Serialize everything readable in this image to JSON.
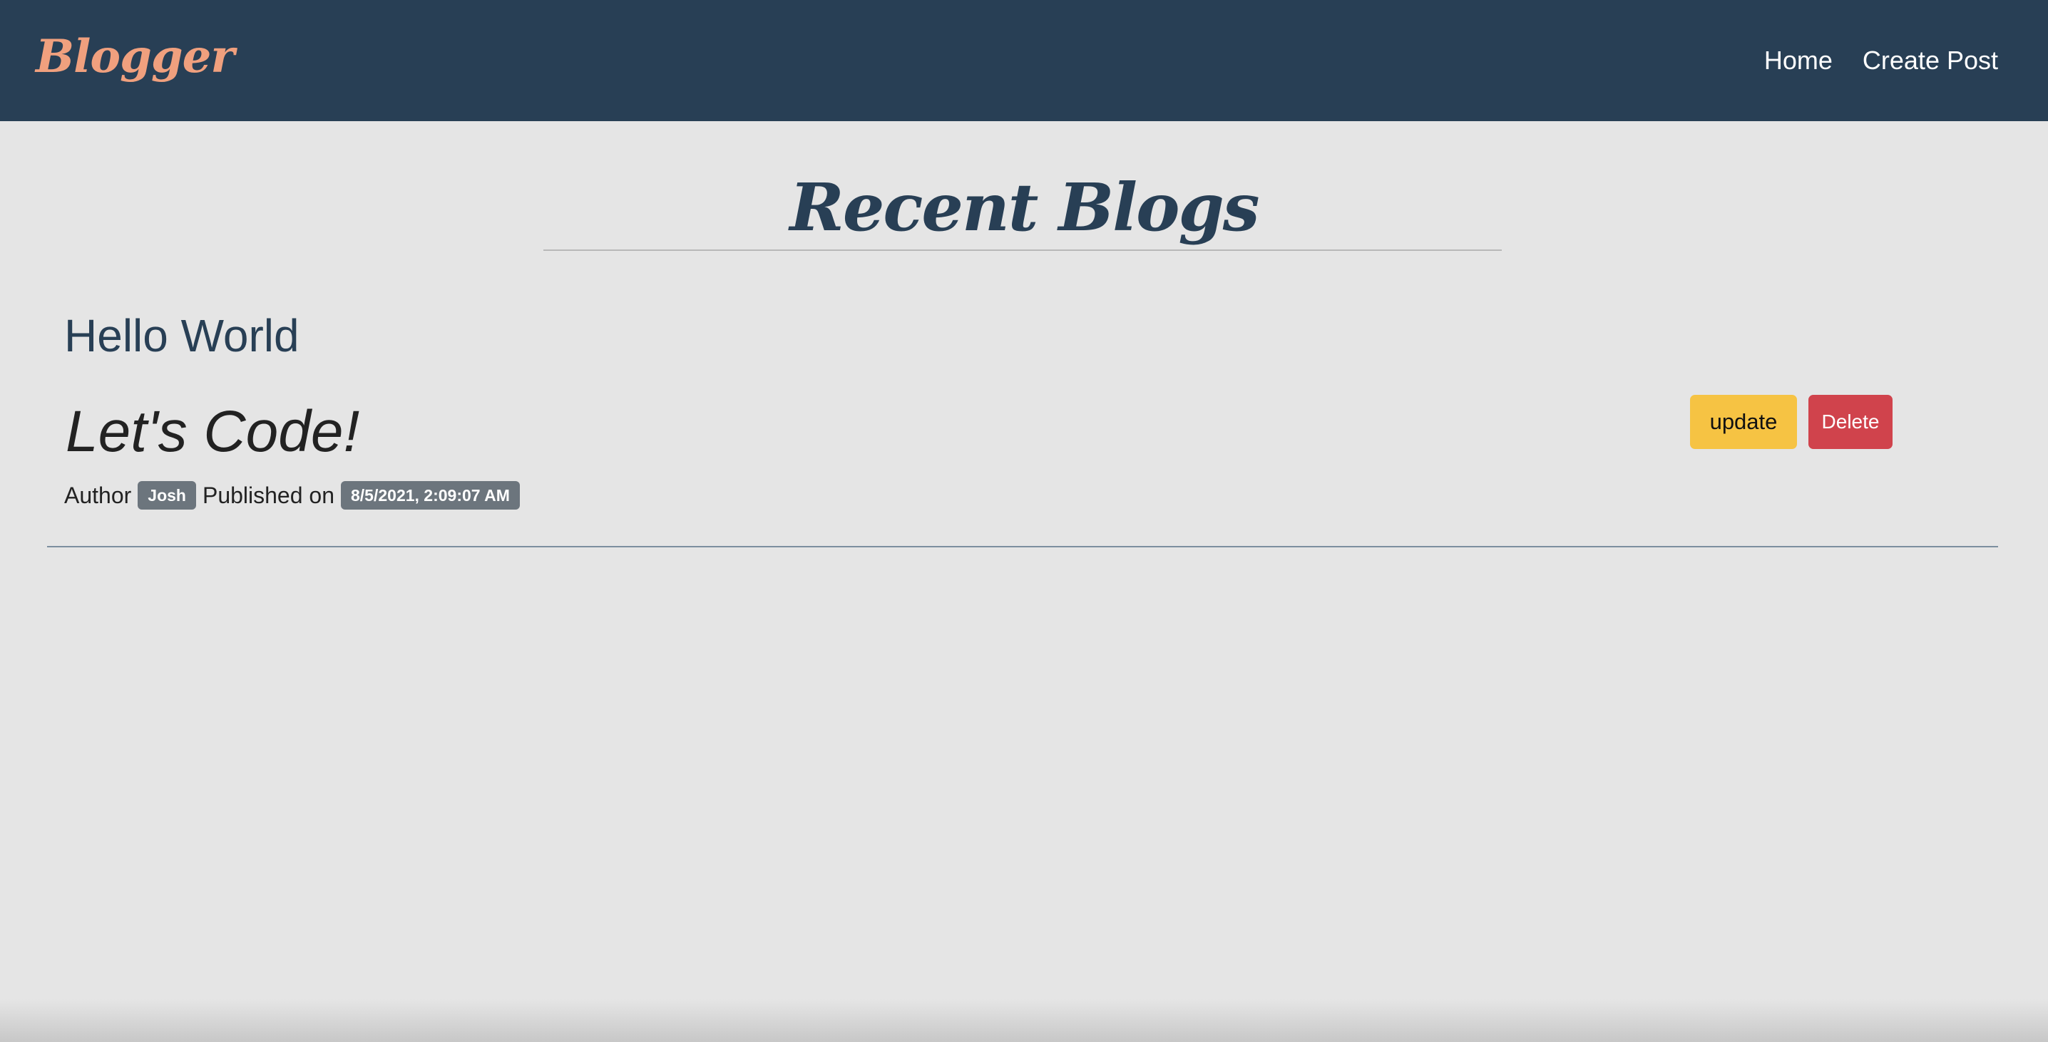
{
  "navbar": {
    "brand": "Blogger",
    "links": [
      {
        "label": "Home"
      },
      {
        "label": "Create Post"
      }
    ],
    "background_color": "#283f55",
    "brand_color": "#f0a07e"
  },
  "main": {
    "title": "Recent Blogs",
    "posts": [
      {
        "title": "Hello World",
        "body": "Let's Code!",
        "author_label": "Author",
        "author": "Josh",
        "published_label": "Published on",
        "published_at": "8/5/2021, 2:09:07 AM",
        "update_label": "update",
        "delete_label": "Delete"
      }
    ]
  },
  "colors": {
    "page_background": "#e5e5e5",
    "update_button": "#f6c343",
    "delete_button": "#d0434c",
    "badge": "#6c757d"
  }
}
